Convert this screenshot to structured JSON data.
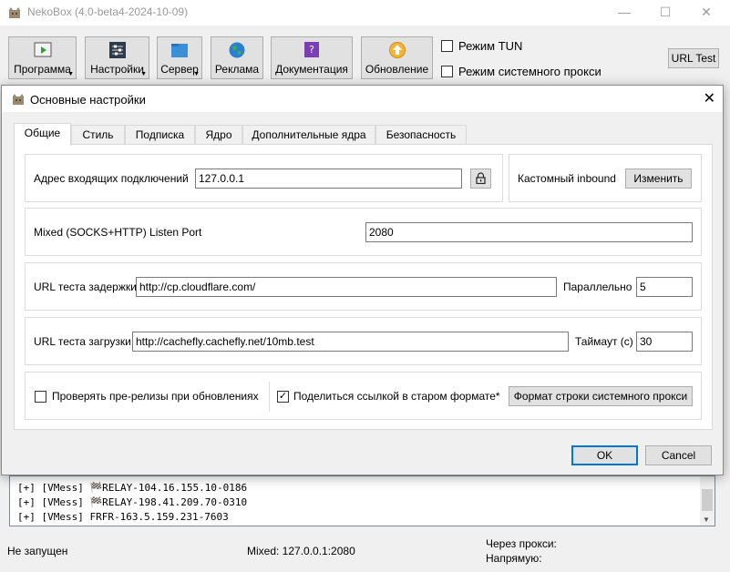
{
  "main_window": {
    "title": "NekoBox (4.0-beta4-2024-10-09)",
    "controls": {
      "minimize": "—",
      "maximize": "☐",
      "close": "✕"
    }
  },
  "toolbar": {
    "buttons": [
      {
        "label": "Программа",
        "icon": "play-icon",
        "dropdown": true
      },
      {
        "label": "Настройки",
        "icon": "sliders-icon",
        "dropdown": true
      },
      {
        "label": "Сервер",
        "icon": "server-folder-icon",
        "dropdown": true
      },
      {
        "label": "Реклама",
        "icon": "globe-icon",
        "dropdown": false
      },
      {
        "label": "Документация",
        "icon": "help-book-icon",
        "dropdown": false
      },
      {
        "label": "Обновление",
        "icon": "update-arrow-icon",
        "dropdown": false
      }
    ],
    "tun_mode_label": "Режим TUN",
    "tun_mode_checked": false,
    "system_proxy_label": "Режим системного прокси",
    "system_proxy_checked": false,
    "url_test_label": "URL Test"
  },
  "dialog": {
    "title": "Основные настройки",
    "close": "✕",
    "tabs": [
      "Общие",
      "Стиль",
      "Подписка",
      "Ядро",
      "Дополнительные ядра",
      "Безопасность"
    ],
    "active_tab": "Общие",
    "inbound_address_label": "Адрес входящих подключений",
    "inbound_address_value": "127.0.0.1",
    "custom_inbound_label": "Кастомный inbound",
    "change_button_label": "Изменить",
    "mixed_port_label": "Mixed (SOCKS+HTTP) Listen Port",
    "mixed_port_value": "2080",
    "latency_url_label": "URL теста задержки",
    "latency_url_value": "http://cp.cloudflare.com/",
    "parallel_label": "Параллельно",
    "parallel_value": "5",
    "download_url_label": "URL теста загрузки",
    "download_url_value": "http://cachefly.cachefly.net/10mb.test",
    "timeout_label": "Таймаут (с)",
    "timeout_value": "30",
    "check_prerelease_label": "Проверять пре-релизы при обновлениях",
    "check_prerelease_checked": false,
    "share_old_format_label": "Поделиться ссылкой в старом формате*",
    "share_old_format_checked": true,
    "system_proxy_format_button": "Формат строки системного прокси",
    "ok_label": "OK",
    "cancel_label": "Cancel"
  },
  "log": {
    "lines": [
      "[+] [VMess] 🏁RELAY-104.16.155.10-0186",
      "[+] [VMess] 🏁RELAY-198.41.209.70-0310",
      "[+] [VMess] FRFR-163.5.159.231-7603"
    ]
  },
  "status_bar": {
    "state": "Не запущен",
    "mixed": "Mixed: 127.0.0.1:2080",
    "via_proxy": "Через прокси:",
    "direct": "Напрямую:"
  },
  "colors": {
    "accent": "#0078d7",
    "button_bg": "#e1e1e1",
    "window_bg": "#f0f0f0"
  }
}
